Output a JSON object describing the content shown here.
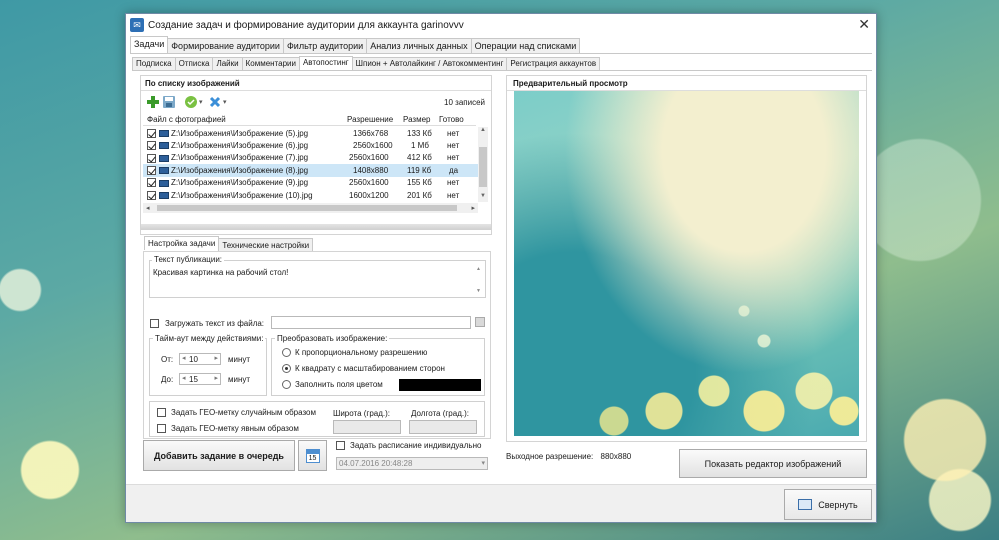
{
  "window": {
    "title": "Создание задач и формирование аудитории для аккаунта garinovvv",
    "close_glyph": "✕"
  },
  "main_tabs": [
    {
      "label": "Задачи",
      "active": true
    },
    {
      "label": "Формирование аудитории",
      "active": false
    },
    {
      "label": "Фильтр аудитории",
      "active": false
    },
    {
      "label": "Анализ личных данных",
      "active": false
    },
    {
      "label": "Операции над списками",
      "active": false
    }
  ],
  "sub_tabs": [
    {
      "label": "Подписка",
      "active": false
    },
    {
      "label": "Отписка",
      "active": false
    },
    {
      "label": "Лайки",
      "active": false
    },
    {
      "label": "Комментарии",
      "active": false
    },
    {
      "label": "Автопостинг",
      "active": true
    },
    {
      "label": "Шпион + Автолайкинг / Автокомментинг",
      "active": false
    },
    {
      "label": "Регистрация аккаунтов",
      "active": false
    }
  ],
  "images_panel": {
    "title": "По списку изображений",
    "record_count": "10 записей",
    "columns": [
      "Файл с фотографией",
      "Разрешение",
      "Размер",
      "Готово"
    ],
    "rows": [
      {
        "file": "Z:\\Изображения\\Изображение (5).jpg",
        "res": "1366x768",
        "size": "133 Кб",
        "done": "нет",
        "selected": false
      },
      {
        "file": "Z:\\Изображения\\Изображение (6).jpg",
        "res": "2560x1600",
        "size": "1 Мб",
        "done": "нет",
        "selected": false
      },
      {
        "file": "Z:\\Изображения\\Изображение (7).jpg",
        "res": "2560x1600",
        "size": "412 Кб",
        "done": "нет",
        "selected": false
      },
      {
        "file": "Z:\\Изображения\\Изображение (8).jpg",
        "res": "1408x880",
        "size": "119 Кб",
        "done": "да",
        "selected": true
      },
      {
        "file": "Z:\\Изображения\\Изображение (9).jpg",
        "res": "2560x1600",
        "size": "155 Кб",
        "done": "нет",
        "selected": false
      },
      {
        "file": "Z:\\Изображения\\Изображение (10).jpg",
        "res": "1600x1200",
        "size": "201 Кб",
        "done": "нет",
        "selected": false
      }
    ]
  },
  "task_tabs": [
    {
      "label": "Настройка задачи",
      "active": true
    },
    {
      "label": "Технические настройки",
      "active": false
    }
  ],
  "publication": {
    "legend": "Текст публикации:",
    "text": "Красивая картинка на рабочий стол!"
  },
  "load_from_file": {
    "label": "Загружать текст из файла:",
    "value": ""
  },
  "timeout": {
    "legend": "Тайм-аут между действиями:",
    "from_label": "От:",
    "from_value": "10",
    "to_label": "До:",
    "to_value": "15",
    "unit": "минут"
  },
  "transform": {
    "legend": "Преобразовать изображение:",
    "options": [
      {
        "label": "К пропорциональному разрешению",
        "selected": false
      },
      {
        "label": "К квадрату с масштабированием сторон",
        "selected": true
      },
      {
        "label": "Заполнить поля цветом",
        "selected": false
      }
    ],
    "fill_color": "#000000"
  },
  "geo": {
    "random_label": "Задать ГЕО-метку случайным образом",
    "explicit_label": "Задать ГЕО-метку явным образом",
    "lat_label": "Широта (град.):",
    "lon_label": "Долгота (град.):"
  },
  "add_task_button": "Добавить задание в очередь",
  "calendar_day": "15",
  "schedule": {
    "label": "Задать расписание индивидуально",
    "datetime": "04.07.2016 20:48:28"
  },
  "preview": {
    "title": "Предварительный просмотр",
    "output_label": "Выходное разрешение:",
    "output_value": "880x880",
    "editor_button": "Показать редактор изображений"
  },
  "collapse_button": "Свернуть"
}
